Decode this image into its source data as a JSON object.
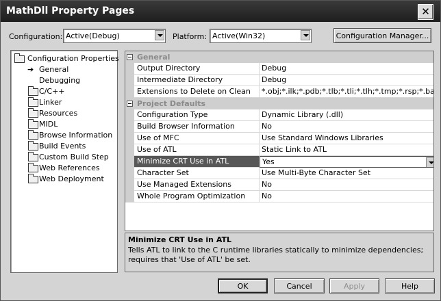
{
  "window": {
    "title": "MathDll Property Pages",
    "close_glyph": "✕"
  },
  "toolbar": {
    "configuration_label": "Configuration:",
    "configuration_value": "Active(Debug)",
    "platform_label": "Platform:",
    "platform_value": "Active(Win32)",
    "manager_button": "Configuration Manager..."
  },
  "tree": {
    "root": "Configuration Properties",
    "items": [
      "General",
      "Debugging",
      "C/C++",
      "Linker",
      "Resources",
      "MIDL",
      "Browse Information",
      "Build Events",
      "Custom Build Step",
      "Web References",
      "Web Deployment"
    ],
    "selected": "General"
  },
  "grid": {
    "categories": [
      {
        "name": "General",
        "rows": [
          {
            "name": "Output Directory",
            "value": "Debug"
          },
          {
            "name": "Intermediate Directory",
            "value": "Debug"
          },
          {
            "name": "Extensions to Delete on Clean",
            "value": "*.obj;*.ilk;*.pdb;*.tlb;*.tli;*.tlh;*.tmp;*.rsp;*.bat;$"
          }
        ]
      },
      {
        "name": "Project Defaults",
        "rows": [
          {
            "name": "Configuration Type",
            "value": "Dynamic Library (.dll)"
          },
          {
            "name": "Build Browser Information",
            "value": "No"
          },
          {
            "name": "Use of MFC",
            "value": "Use Standard Windows Libraries"
          },
          {
            "name": "Use of ATL",
            "value": "Static Link to ATL"
          },
          {
            "name": "Minimize CRT Use in ATL",
            "value": "Yes"
          },
          {
            "name": "Character Set",
            "value": "Use Multi-Byte Character Set"
          },
          {
            "name": "Use Managed Extensions",
            "value": "No"
          },
          {
            "name": "Whole Program Optimization",
            "value": "No"
          }
        ]
      }
    ],
    "selected_row": "Minimize CRT Use in ATL"
  },
  "description": {
    "title": "Minimize CRT Use in ATL",
    "text": "Tells ATL to link to the C runtime libraries statically to minimize dependencies; requires that 'Use of ATL' be set."
  },
  "buttons": {
    "ok": "OK",
    "cancel": "Cancel",
    "apply": "Apply",
    "help": "Help"
  },
  "colors": {
    "title_bar": "#262626",
    "selected_row": "#575757",
    "dialog_bg": "#d4d4d4"
  }
}
